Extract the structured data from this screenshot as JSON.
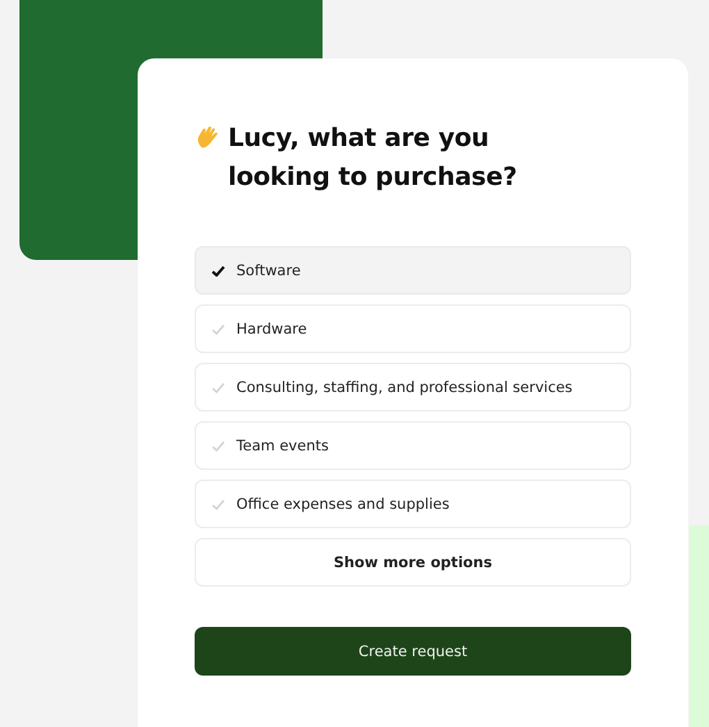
{
  "heading": "Lucy, what are you looking to purchase?",
  "options": [
    {
      "label": "Software",
      "selected": true
    },
    {
      "label": "Hardware",
      "selected": false
    },
    {
      "label": "Consulting, staffing, and professional services",
      "selected": false
    },
    {
      "label": "Team events",
      "selected": false
    },
    {
      "label": "Office expenses and supplies",
      "selected": false
    }
  ],
  "more_button": "Show more options",
  "submit_button": "Create request"
}
